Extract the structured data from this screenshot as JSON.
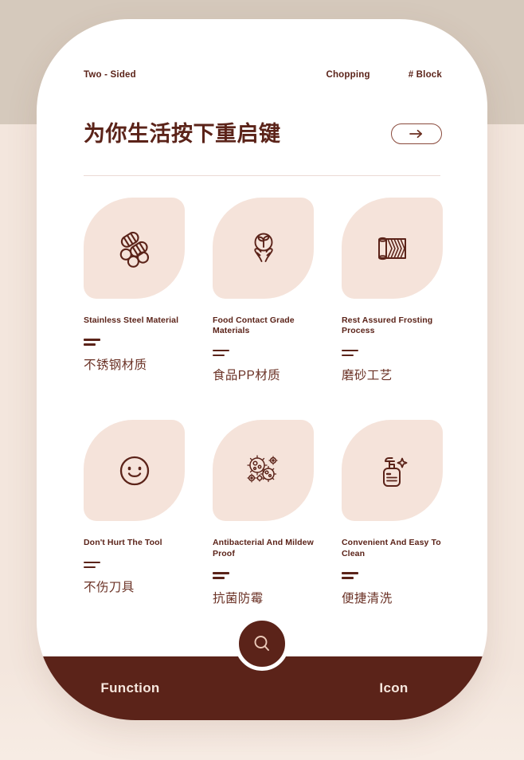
{
  "theme": {
    "brand_dark": "#5B2319",
    "tile_blush": "#F5E3DA",
    "card_white": "#FFFFFF",
    "bg_taupe": "#D5C9BC",
    "bg_blush": "#F3E6DD",
    "rule_pink": "#EBDAD4"
  },
  "topnav": {
    "left_label": "Two - Sided",
    "center_label": "Chopping",
    "right_label": "# Block"
  },
  "header": {
    "title": "为你生活按下重启键",
    "arrow_icon": "arrow-right-icon"
  },
  "features": [
    {
      "icon": "steel-pipes-icon",
      "title_en": "Stainless Steel Material",
      "title_cn": "不锈钢材质"
    },
    {
      "icon": "hands-sprout-icon",
      "title_en": "Food Contact Grade Materials",
      "title_cn": "食品PP材质"
    },
    {
      "icon": "frosted-mat-roll-icon",
      "title_en": "Rest Assured Frosting Process",
      "title_cn": "磨砂工艺"
    },
    {
      "icon": "smiley-face-icon",
      "title_en": "Don't Hurt The Tool",
      "title_cn": "不伤刀具"
    },
    {
      "icon": "bacteria-germs-icon",
      "title_en": "Antibacterial And Mildew Proof",
      "title_cn": "抗菌防霉"
    },
    {
      "icon": "soap-dispenser-icon",
      "title_en": "Convenient And Easy To Clean",
      "title_cn": "便捷清洗"
    }
  ],
  "bottombar": {
    "left_tab": "Function",
    "right_tab": "Icon",
    "fab_icon": "search-icon"
  }
}
